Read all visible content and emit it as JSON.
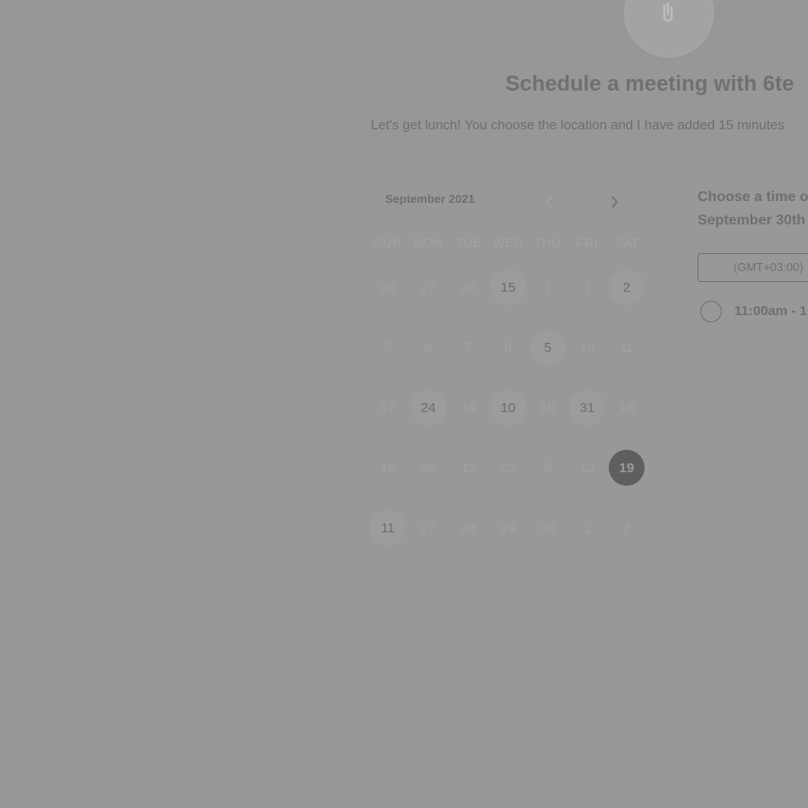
{
  "header": {
    "title": "Schedule a meeting with 6te",
    "subtitle": "Let's get lunch! You choose the location and I have added 15 minutes"
  },
  "calendar": {
    "month_label": "September 2021",
    "weekdays": [
      "SUN",
      "MON",
      "TUE",
      "WED",
      "THU",
      "FRI",
      "SAT"
    ],
    "weeks": [
      [
        {
          "t": "26"
        },
        {
          "t": "27"
        },
        {
          "t": "28"
        },
        {
          "t": "15",
          "s": "available"
        },
        {
          "t": "1"
        },
        {
          "t": "1"
        },
        {
          "t": "2",
          "s": "available"
        }
      ],
      [
        {
          "t": "5"
        },
        {
          "t": "6"
        },
        {
          "t": "7"
        },
        {
          "t": "8"
        },
        {
          "t": "5",
          "s": "available"
        },
        {
          "t": "10"
        },
        {
          "t": "11"
        }
      ],
      [
        {
          "t": "12"
        },
        {
          "t": "24",
          "s": "available"
        },
        {
          "t": "14"
        },
        {
          "t": "10",
          "s": "available"
        },
        {
          "t": "16"
        },
        {
          "t": "31",
          "s": "available"
        },
        {
          "t": "18"
        }
      ],
      [
        {
          "t": "19"
        },
        {
          "t": "20"
        },
        {
          "t": "12"
        },
        {
          "t": "22"
        },
        {
          "t": "5"
        },
        {
          "t": "12"
        },
        {
          "t": "19",
          "s": "selected"
        }
      ],
      [
        {
          "t": "11",
          "s": "available"
        },
        {
          "t": "27"
        },
        {
          "t": "28"
        },
        {
          "t": "29"
        },
        {
          "t": "30"
        },
        {
          "t": "1"
        },
        {
          "t": "2"
        }
      ]
    ]
  },
  "times": {
    "heading_line1": "Choose a time o",
    "heading_line2": "September 30th",
    "timezone": "(GMT+03:00)",
    "slots": [
      "11:00am - 1"
    ]
  },
  "icons": {
    "prev": "chevron-left-icon",
    "next": "chevron-right-icon",
    "avatar": "paperclip-icon"
  }
}
